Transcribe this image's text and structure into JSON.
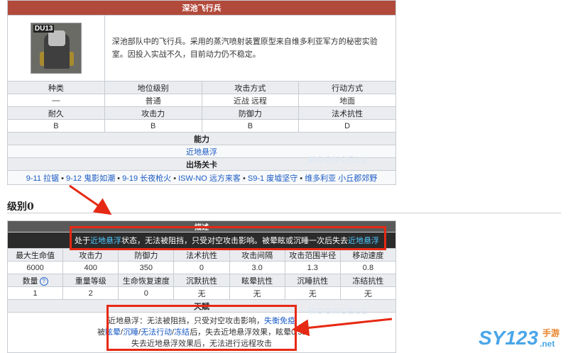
{
  "enemy": {
    "title": "深池飞行兵",
    "portrait_tag": "DU13",
    "description": "深池部队中的飞行兵。采用的蒸汽喷射装置原型来自维多利亚军方的秘密实验室。因投入实战不久，目前动力仍不稳定。",
    "info_headers": [
      "种类",
      "地位级别",
      "攻击方式",
      "行动方式"
    ],
    "info_values": [
      "—",
      "普通",
      "近战 远程",
      "地面"
    ],
    "stat_headers": [
      "耐久",
      "攻击力",
      "防御力",
      "法术抗性"
    ],
    "stat_values": [
      "B",
      "B",
      "B",
      "D"
    ],
    "ability_label": "能力",
    "ability_value": "近地悬浮",
    "stages_label": "出场关卡",
    "stages": [
      "9-11 拉锯",
      "9-12 鬼影如潮",
      "9-19 长夜枪火",
      "ISW-NO 远方来客",
      "S9-1 废墟坚守",
      "维多利亚 小丘郡郊野"
    ],
    "stage_separator": "•"
  },
  "section": {
    "title": "级别0"
  },
  "level": {
    "desc_label": "描述",
    "desc_parts": [
      "处于",
      "近地悬浮",
      "状态，无法被阻挡，只受对空攻击影响。被晕眩或沉睡一次后失去",
      "近地悬浮"
    ],
    "row1_headers": [
      "最大生命值",
      "攻击力",
      "防御力",
      "法术抗性",
      "攻击间隔",
      "攻击范围半径",
      "移动速度"
    ],
    "row1_values": [
      "6000",
      "400",
      "350",
      "0",
      "3.0",
      "1.3",
      "0.8"
    ],
    "row2_headers": [
      "数量",
      "重量等级",
      "生命恢复速度",
      "沉默抗性",
      "眩晕抗性",
      "沉睡抗性",
      "冻结抗性"
    ],
    "row2_values": [
      "1",
      "2",
      "0",
      "无",
      "无",
      "无",
      "无"
    ],
    "help_symbol": "?",
    "talent_label": "天赋",
    "talent_line1_a": "近地悬浮：无法被阻挡，只受对空攻击影响，",
    "talent_line1_link": "失衡免疫",
    "talent_line2_a": "被",
    "talent_line2_links": [
      "眩晕",
      "沉睡",
      "无法行动",
      "冻结"
    ],
    "talent_line2_b": "后，失去近地悬浮效果，眩晕0.5s",
    "talent_line3": "失去近地悬浮效果后，无法进行远程攻击"
  },
  "watermark": "MOONCELL",
  "site_logo": {
    "main": "SY123",
    "sub": "手游",
    "domain": ".net"
  },
  "colors": {
    "header_red": "#b24a3b",
    "link_blue": "#1a5bc4",
    "annotation_red": "#e62914",
    "cyan": "#4fc8ff"
  }
}
